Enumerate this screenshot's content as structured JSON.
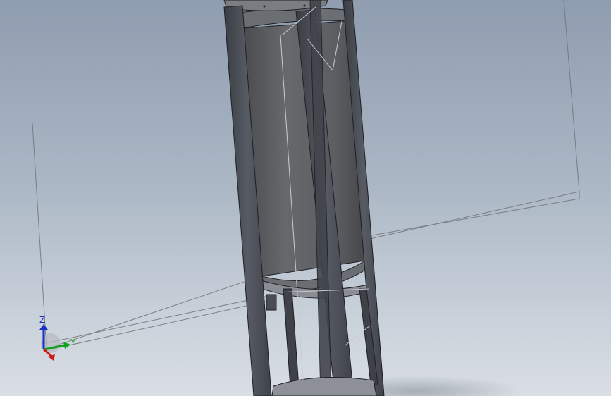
{
  "viewport": {
    "background_top": "#8f9db0",
    "background_bottom": "#d9dee4"
  },
  "model": {
    "frame_color": "#4c5058",
    "frame_shadow": "#2e3138",
    "tank_color": "#5f6166",
    "edge_color": "#1e2024"
  },
  "triad": {
    "z_label": "Z",
    "y_label": "Y",
    "z_color": "#1a2fc8",
    "y_color": "#12a020",
    "x_color": "#d01818"
  }
}
